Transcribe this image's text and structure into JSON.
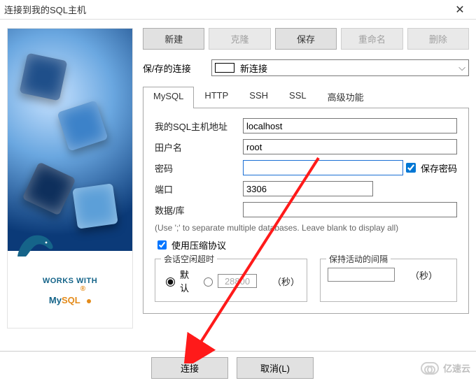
{
  "window": {
    "title": "连接到我的SQL主机"
  },
  "toolbar": {
    "new": "新建",
    "clone": "克隆",
    "save": "保存",
    "rename": "重命名",
    "delete": "删除"
  },
  "savedConn": {
    "label": "保/存的连接",
    "selected": "新连接"
  },
  "tabs": {
    "mysql": "MySQL",
    "http": "HTTP",
    "ssh": "SSH",
    "ssl": "SSL",
    "advanced": "高级功能"
  },
  "form": {
    "hostLabel": "我的SQL主机地址",
    "hostValue": "localhost",
    "userLabel": "田户名",
    "userValue": "root",
    "passLabel": "密码",
    "passValue": "",
    "savePassLabel": "保存密码",
    "portLabel": "端口",
    "portValue": "3306",
    "dbLabel": "数据/库",
    "dbValue": "",
    "dbHint": "(Use ';' to separate multiple databases. Leave blank to display all)",
    "compressLabel": "使用压缩协议"
  },
  "idle": {
    "legend": "会话空闲超时",
    "defaultLabel": "默认",
    "customValue": "28800",
    "unit": "（秒）"
  },
  "keepAlive": {
    "legend": "保持活动的间隔",
    "value": "",
    "unit": "（秒）"
  },
  "bottom": {
    "connect": "连接",
    "cancel": "取消(L)"
  },
  "logo": {
    "worksWith": "WORKS WITH",
    "my": "My",
    "sql": "SQL"
  },
  "watermark": "亿速云"
}
